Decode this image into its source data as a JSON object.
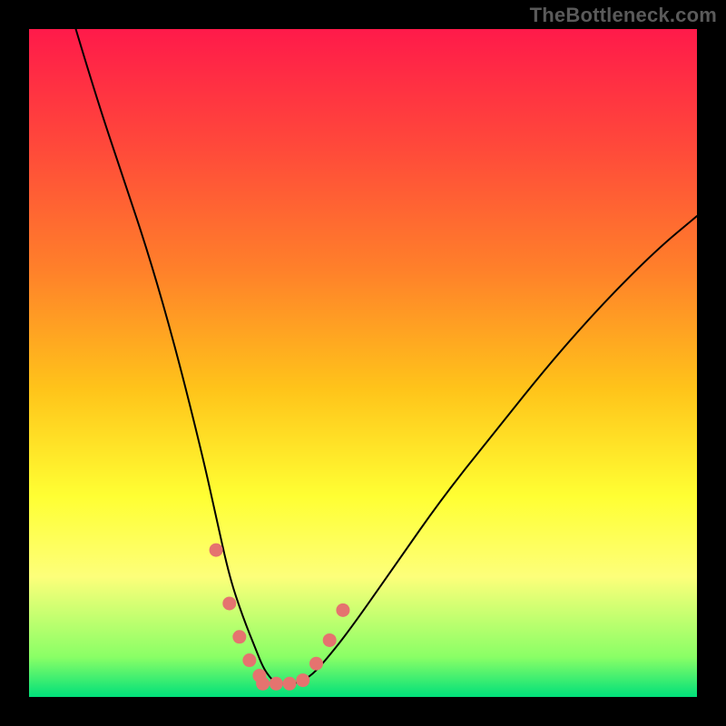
{
  "watermark": "TheBottleneck.com",
  "chart_data": {
    "type": "line",
    "title": "",
    "xlabel": "",
    "ylabel": "",
    "xlim": [
      0,
      100
    ],
    "ylim": [
      0,
      100
    ],
    "grid": false,
    "legend": false,
    "series": [
      {
        "name": "bottleneck-curve",
        "color": "#000000",
        "x": [
          7,
          10,
          14,
          18,
          22,
          26,
          28,
          30,
          32,
          34,
          35,
          36,
          37,
          38,
          40,
          42,
          44,
          48,
          55,
          62,
          70,
          78,
          86,
          94,
          100
        ],
        "y": [
          100,
          90,
          78,
          66,
          52,
          36,
          27,
          18,
          12,
          7,
          4.5,
          3,
          2,
          2,
          2,
          3,
          5,
          10,
          20,
          30,
          40,
          50,
          59,
          67,
          72
        ]
      },
      {
        "name": "highlight-left",
        "color": "#e5736f",
        "x": [
          28,
          30,
          31.5,
          33,
          34.5
        ],
        "y": [
          22,
          14,
          9,
          5.5,
          3.2
        ]
      },
      {
        "name": "highlight-bottom",
        "color": "#e5736f",
        "x": [
          35,
          37,
          39,
          41
        ],
        "y": [
          2,
          2,
          2,
          2.5
        ]
      },
      {
        "name": "highlight-right",
        "color": "#e5736f",
        "x": [
          43,
          45,
          47
        ],
        "y": [
          5,
          8.5,
          13
        ]
      }
    ]
  }
}
